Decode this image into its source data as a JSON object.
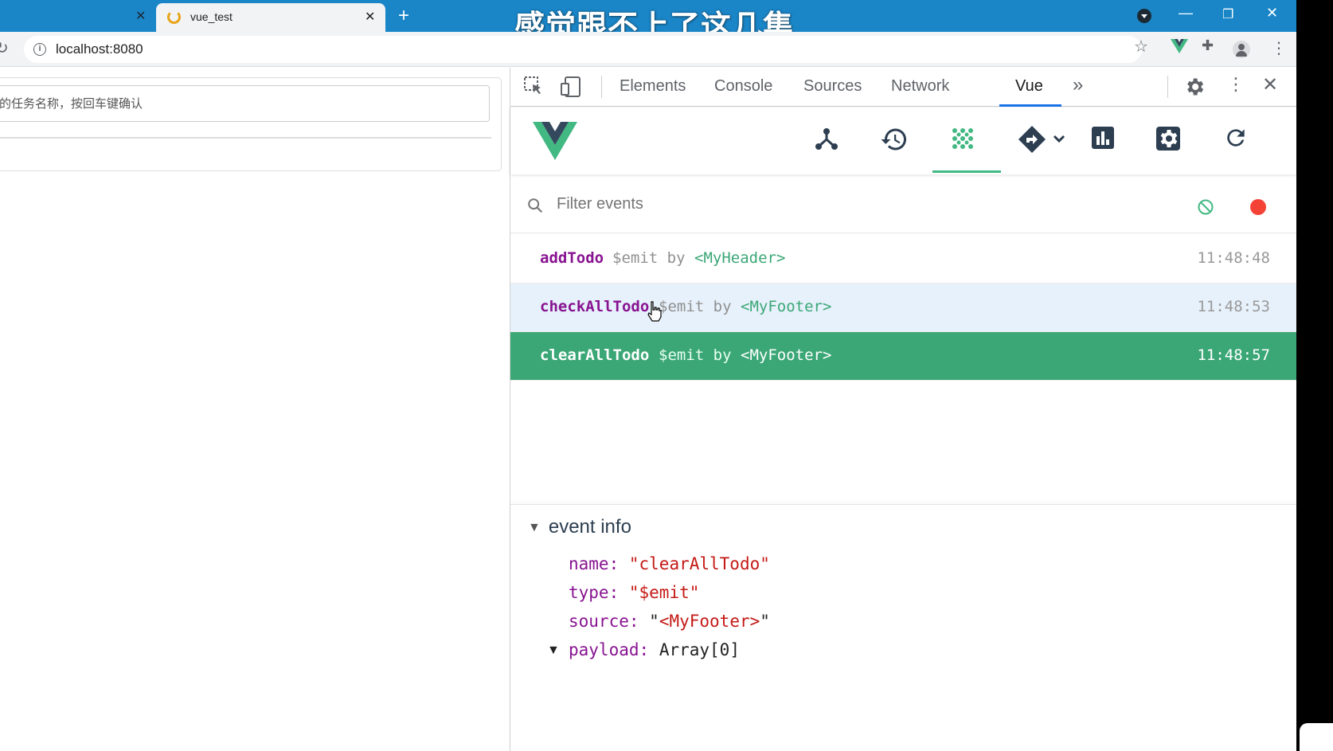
{
  "browser": {
    "tabs": [
      {
        "title": "",
        "close": "✕"
      },
      {
        "title": "vue_test",
        "close": "✕"
      }
    ],
    "new_tab": "+",
    "video_subtitle": "感觉跟不上了这几集",
    "window_controls": {
      "minimize": "—",
      "restore": "❐",
      "close": "✕"
    },
    "url": "localhost:8080"
  },
  "page": {
    "todo_input_placeholder": "的任务名称，按回车键确认"
  },
  "devtools": {
    "tabs": [
      "Elements",
      "Console",
      "Sources",
      "Network",
      "Vue"
    ],
    "active_tab": "Vue",
    "more": "»",
    "vue_toolbar": {
      "icons": [
        "components-icon",
        "history-icon",
        "events-icon",
        "router-icon",
        "performance-icon",
        "settings-icon",
        "refresh-icon"
      ],
      "active": "events-icon"
    },
    "filter_placeholder": "Filter events",
    "events": [
      {
        "name": "addTodo",
        "type": "$emit",
        "by": "by",
        "source": "<MyHeader>",
        "time": "11:48:48"
      },
      {
        "name": "checkAllTodo",
        "type": "$emit",
        "by": "by",
        "source": "<MyFooter>",
        "time": "11:48:53"
      },
      {
        "name": "clearAllTodo",
        "type": "$emit",
        "by": "by",
        "source": "<MyFooter>",
        "time": "11:48:57"
      }
    ],
    "selected_event": "clearAllTodo",
    "event_info": {
      "header": "event info",
      "name_key": "name:",
      "name_val": "\"clearAllTodo\"",
      "type_key": "type:",
      "type_val": "\"$emit\"",
      "source_key": "source:",
      "source_q1": "\"",
      "source_val": "<MyFooter>",
      "source_q2": "\"",
      "payload_key": "payload:",
      "payload_val": "Array[0]"
    }
  },
  "colors": {
    "titlebar": "#1a86c8",
    "vue_green": "#42b883",
    "selected_row": "#3ba776",
    "hover_row": "#e7f1fb",
    "event_name": "#881391",
    "record": "#f44336"
  }
}
